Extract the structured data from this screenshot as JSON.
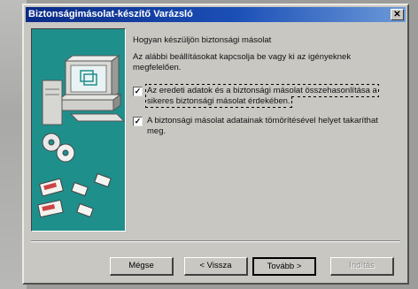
{
  "window": {
    "title": "Biztonságimásolat-készítő Varázsló",
    "close_glyph": "✕"
  },
  "content": {
    "heading": "Hogyan készüljön biztonsági másolat",
    "intro": "Az alábbi beállításokat kapcsolja be vagy ki az igényeknek megfelelően.",
    "options": [
      {
        "label": "Az eredeti adatok és a biztonsági másolat összehasonlítása a sikeres biztonsági másolat érdekében.",
        "checked": true
      },
      {
        "label": "A biztonsági másolat adatainak tömörítésével helyet takaríthat meg.",
        "checked": true
      }
    ]
  },
  "buttons": {
    "cancel": "Mégse",
    "back": "< Vissza",
    "next": "Tovább >",
    "finish": "Indítás"
  },
  "colors": {
    "titlebar_start": "#0a2a86",
    "titlebar_end": "#6c9ad8",
    "illustration_bg": "#1f8f8c",
    "dialog_bg": "#c8c7c2"
  },
  "icons": {
    "illustration": "computer-with-disks-illustration",
    "close": "close-icon"
  }
}
